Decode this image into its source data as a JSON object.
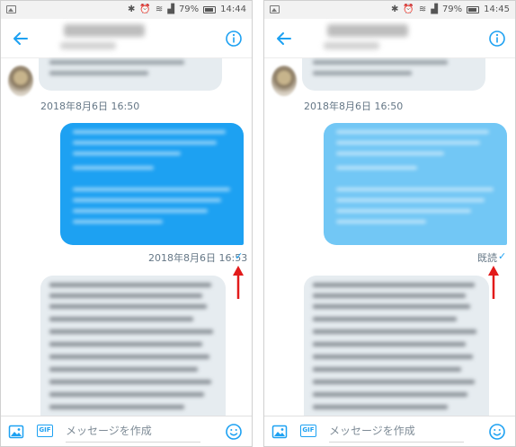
{
  "screens": [
    {
      "status_time": "14:44",
      "battery": "79%",
      "date_label": "2018年8月6日 16:50",
      "sent_status": "2018年8月6日 16:53",
      "check_mark": "✓",
      "sent_bubble_color": "#1da1f2",
      "composer_placeholder": "メッセージを作成",
      "gif_label": "GIF"
    },
    {
      "status_time": "14:45",
      "battery": "79%",
      "date_label": "2018年8月6日 16:50",
      "sent_status": "既読",
      "check_mark": "✓",
      "sent_bubble_color": "#72c7f5",
      "composer_placeholder": "メッセージを作成",
      "gif_label": "GIF"
    }
  ],
  "icons": [
    "gallery-icon",
    "bluetooth-icon",
    "alarm-icon",
    "wifi-icon",
    "signal-icon",
    "battery-icon",
    "back-arrow-icon",
    "info-icon",
    "image-icon",
    "gif-icon",
    "emoji-icon"
  ],
  "colors": {
    "accent": "#1da1f2",
    "bubble_received": "#e6ecf0",
    "arrow_annotation": "#e21b1b"
  }
}
